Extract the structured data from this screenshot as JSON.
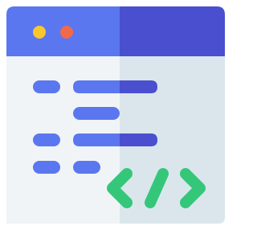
{
  "icon": {
    "title_bar_color": "#5B77EF",
    "title_bar_shade_color": "#4A4FCF",
    "body_color": "#F0F4F6",
    "body_shade_color": "#DAE6EC",
    "window_dot_colors": [
      "#F9C72C",
      "#F06A4A"
    ],
    "code_line_color": "#5B77EF",
    "code_line_shade_color": "#4A4FCF",
    "code_symbol_color": "#34C77A",
    "code_symbol_icon": "code-brackets-icon"
  }
}
